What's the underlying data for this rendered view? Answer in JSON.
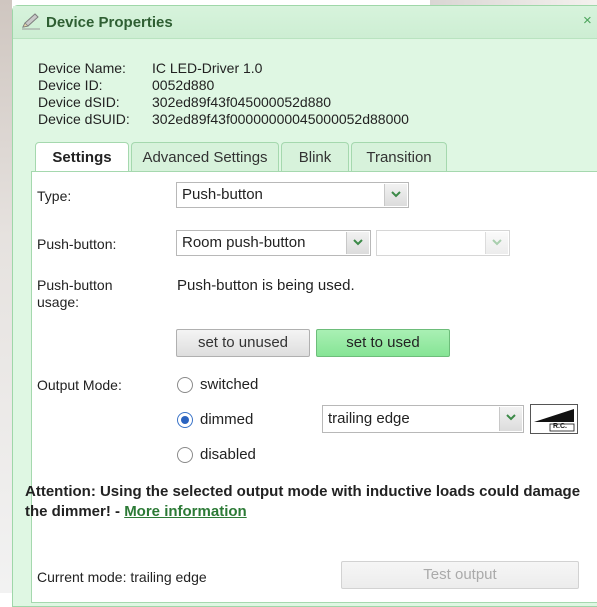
{
  "window": {
    "title": "Device Properties",
    "close_glyph": "×",
    "title_icon": "pencil-edit-icon"
  },
  "device_info": {
    "name_label": "Device Name:",
    "name_value": "IC LED-Driver 1.0",
    "id_label": "Device ID:",
    "id_value": "0052d880",
    "dsid_label": "Device dSID:",
    "dsid_value": "302ed89f43f045000052d880",
    "dsuid_label": "Device dSUID:",
    "dsuid_value": "302ed89f43f00000000045000052d88000"
  },
  "tabs": [
    {
      "label": "Settings",
      "active": true
    },
    {
      "label": "Advanced Settings",
      "active": false
    },
    {
      "label": "Blink",
      "active": false
    },
    {
      "label": "Transition",
      "active": false
    }
  ],
  "settings": {
    "type_label": "Type:",
    "type_value": "Push-button",
    "pushbutton_label": "Push-button:",
    "pushbutton_value": "Room push-button",
    "pushbutton_secondary_value": "",
    "usage_label": "Push-button usage:",
    "usage_value": "Push-button is being used.",
    "set_unused_label": "set to unused",
    "set_used_label": "set to used",
    "output_mode_label": "Output Mode:",
    "output_modes": [
      {
        "label": "switched",
        "selected": false
      },
      {
        "label": "dimmed",
        "selected": true
      },
      {
        "label": "disabled",
        "selected": false
      }
    ],
    "dimming_mode_value": "trailing edge",
    "rc_icon_label": "R.C.",
    "attention_text": "Attention: Using the selected output mode with inductive loads could damage the dimmer! - ",
    "more_info_link": "More information",
    "current_mode_text": "Current mode: trailing edge",
    "test_output_label": "Test output"
  },
  "colors": {
    "dialog_bg": "#dff7e3",
    "accent_green": "#86e495",
    "link_green": "#2c7a36"
  }
}
